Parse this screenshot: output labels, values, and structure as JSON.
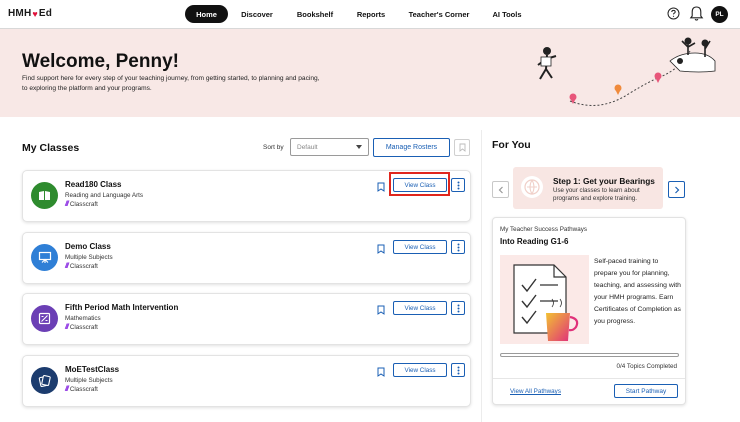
{
  "nav": {
    "logo_text": "HMH",
    "logo_suffix": "Ed",
    "items": [
      {
        "label": "Home",
        "active": true
      },
      {
        "label": "Discover",
        "active": false
      },
      {
        "label": "Bookshelf",
        "active": false
      },
      {
        "label": "Reports",
        "active": false
      },
      {
        "label": "Teacher's Corner",
        "active": false
      },
      {
        "label": "AI Tools",
        "active": false
      }
    ],
    "icons": [
      "help-icon",
      "bell-icon"
    ],
    "avatar_initials": "PL"
  },
  "hero": {
    "title": "Welcome, Penny!",
    "subtitle": "Find support here for every step of your teaching journey, from getting started, to planning and pacing, to exploring the platform and your programs."
  },
  "my_classes": {
    "title": "My Classes",
    "sort_label": "Sort by",
    "sort_value": "Default",
    "manage_rosters_label": "Manage Rosters",
    "view_class_label": "View Class",
    "classcraft_label": "Classcraft",
    "classes": [
      {
        "name": "Read180 Class",
        "subject": "Reading and Language Arts",
        "icon": "book-icon",
        "color": "#2e8b2e"
      },
      {
        "name": "Demo Class",
        "subject": "Multiple Subjects",
        "icon": "presentation-icon",
        "color": "#2f7fd6"
      },
      {
        "name": "Fifth Period Math Intervention",
        "subject": "Mathematics",
        "icon": "math-icon",
        "color": "#6b3fb5"
      },
      {
        "name": "MoETestClass",
        "subject": "Multiple Subjects",
        "icon": "cards-icon",
        "color": "#1c3c6e"
      }
    ]
  },
  "for_you": {
    "title": "For You",
    "bearing": {
      "title": "Step 1: Get your Bearings",
      "description": "Use your classes to learn about programs and explore training."
    },
    "pathway": {
      "eyebrow": "My Teacher Success Pathways",
      "title": "Into Reading G1-6",
      "description": "Self-paced training to prepare you for planning, teaching, and assessing with your HMH programs. Earn Certificates of Completion as you progress.",
      "progress": 0,
      "topics_completed": "0/4 Topics Completed",
      "view_all_label": "View All Pathways",
      "start_label": "Start Pathway"
    }
  },
  "colors": {
    "accent": "#1a5fb4",
    "hero_bg": "#f8e8e6",
    "highlight": "#e0261d",
    "classcraft": "#8a2be2"
  }
}
